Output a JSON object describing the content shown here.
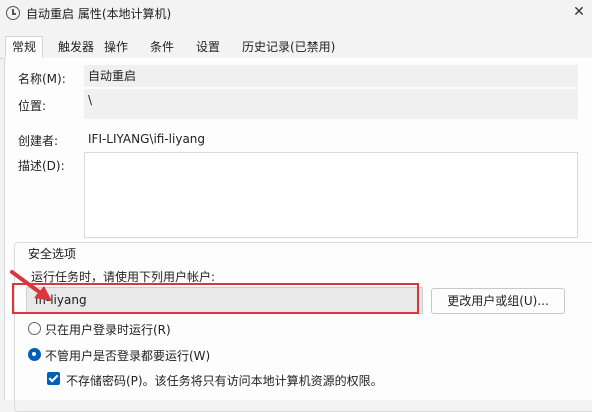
{
  "window": {
    "title": "自动重启 属性(本地计算机)",
    "close_label": "✕"
  },
  "tabs": [
    {
      "label": "常规",
      "active": true
    },
    {
      "label": "触发器"
    },
    {
      "label": "操作"
    },
    {
      "label": "条件"
    },
    {
      "label": "设置"
    },
    {
      "label": "历史记录(已禁用)"
    }
  ],
  "general": {
    "name_label": "名称(M):",
    "name_value": "自动重启",
    "location_label": "位置:",
    "location_value": "\\",
    "author_label": "创建者:",
    "author_value": "IFI-LIYANG\\ifi-liyang",
    "description_label": "描述(D):",
    "description_value": ""
  },
  "security": {
    "group_title": "安全选项",
    "run_as_prompt": "运行任务时，请使用下列用户帐户:",
    "account_value": "ifi-liyang",
    "change_button": "更改用户或组(U)...",
    "radio_logged_on": "只在用户登录时运行(R)",
    "radio_logged_on_selected": false,
    "radio_whether_logged": "不管用户是否登录都要运行(W)",
    "radio_whether_logged_selected": true,
    "checkbox_no_store_password": "不存储密码(P)。该任务将只有访问本地计算机资源的权限。",
    "checkbox_checked": true
  },
  "colors": {
    "accent": "#005fb8",
    "highlight_border": "#d9363e"
  }
}
